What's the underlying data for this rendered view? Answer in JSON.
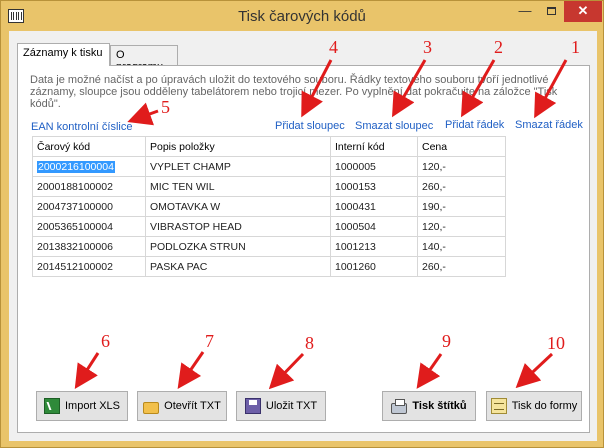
{
  "window": {
    "title": "Tisk čarových kódů",
    "minimize_glyph": "—",
    "close_glyph": "✕"
  },
  "tabs": [
    {
      "label": "Záznamy k tisku",
      "active": true
    },
    {
      "label": "O programu",
      "active": false
    }
  ],
  "info_text": "Data je možné  načíst a po úpravách  uložit do  textového  souboru.  Řádky  textového souboru tvoří jednotlivé záznamy, sloupce jsou odděleny tabelátorem nebo trojicí mezer. Po vyplnění dat pokračujte na záložce \"Tisk kódů\".",
  "links": {
    "ean": "EAN kontrolní číslice",
    "add_column": "Přidat sloupec",
    "delete_column": "Smazat sloupec",
    "add_row": "Přidat řádek",
    "delete_row": "Smazat řádek"
  },
  "table": {
    "columns": [
      "Čarový kód",
      "Popis položky",
      "Interní kód",
      "Cena"
    ],
    "rows": [
      [
        "2000216100004",
        "VYPLET CHAMP",
        "1000005",
        "120,-"
      ],
      [
        "2000188100002",
        "MIC TEN WIL",
        "1000153",
        "260,-"
      ],
      [
        "2004737100000",
        "OMOTAVKA W",
        "1000431",
        "190,-"
      ],
      [
        "2005365100004",
        "VIBRASTOP HEAD",
        "1000504",
        "120,-"
      ],
      [
        "2013832100006",
        "PODLOZKA STRUN",
        "1001213",
        "140,-"
      ],
      [
        "2014512100002",
        "PASKA PAC",
        "1001260",
        "260,-"
      ]
    ],
    "selected_cell": "2000216100004"
  },
  "buttons": {
    "import_xls": "Import XLS",
    "open_txt": "Otevřít TXT",
    "save_txt": "Uložit TXT",
    "print_labels": "Tisk štítků",
    "print_form": "Tisk do formy"
  },
  "callouts": [
    "1",
    "2",
    "3",
    "4",
    "5",
    "6",
    "7",
    "8",
    "9",
    "10"
  ],
  "colors": {
    "titlebar": "#e9c46a",
    "close_button": "#c7372f",
    "link": "#1f5fc4",
    "selection": "#3399ff",
    "callout": "#e01c1c"
  }
}
